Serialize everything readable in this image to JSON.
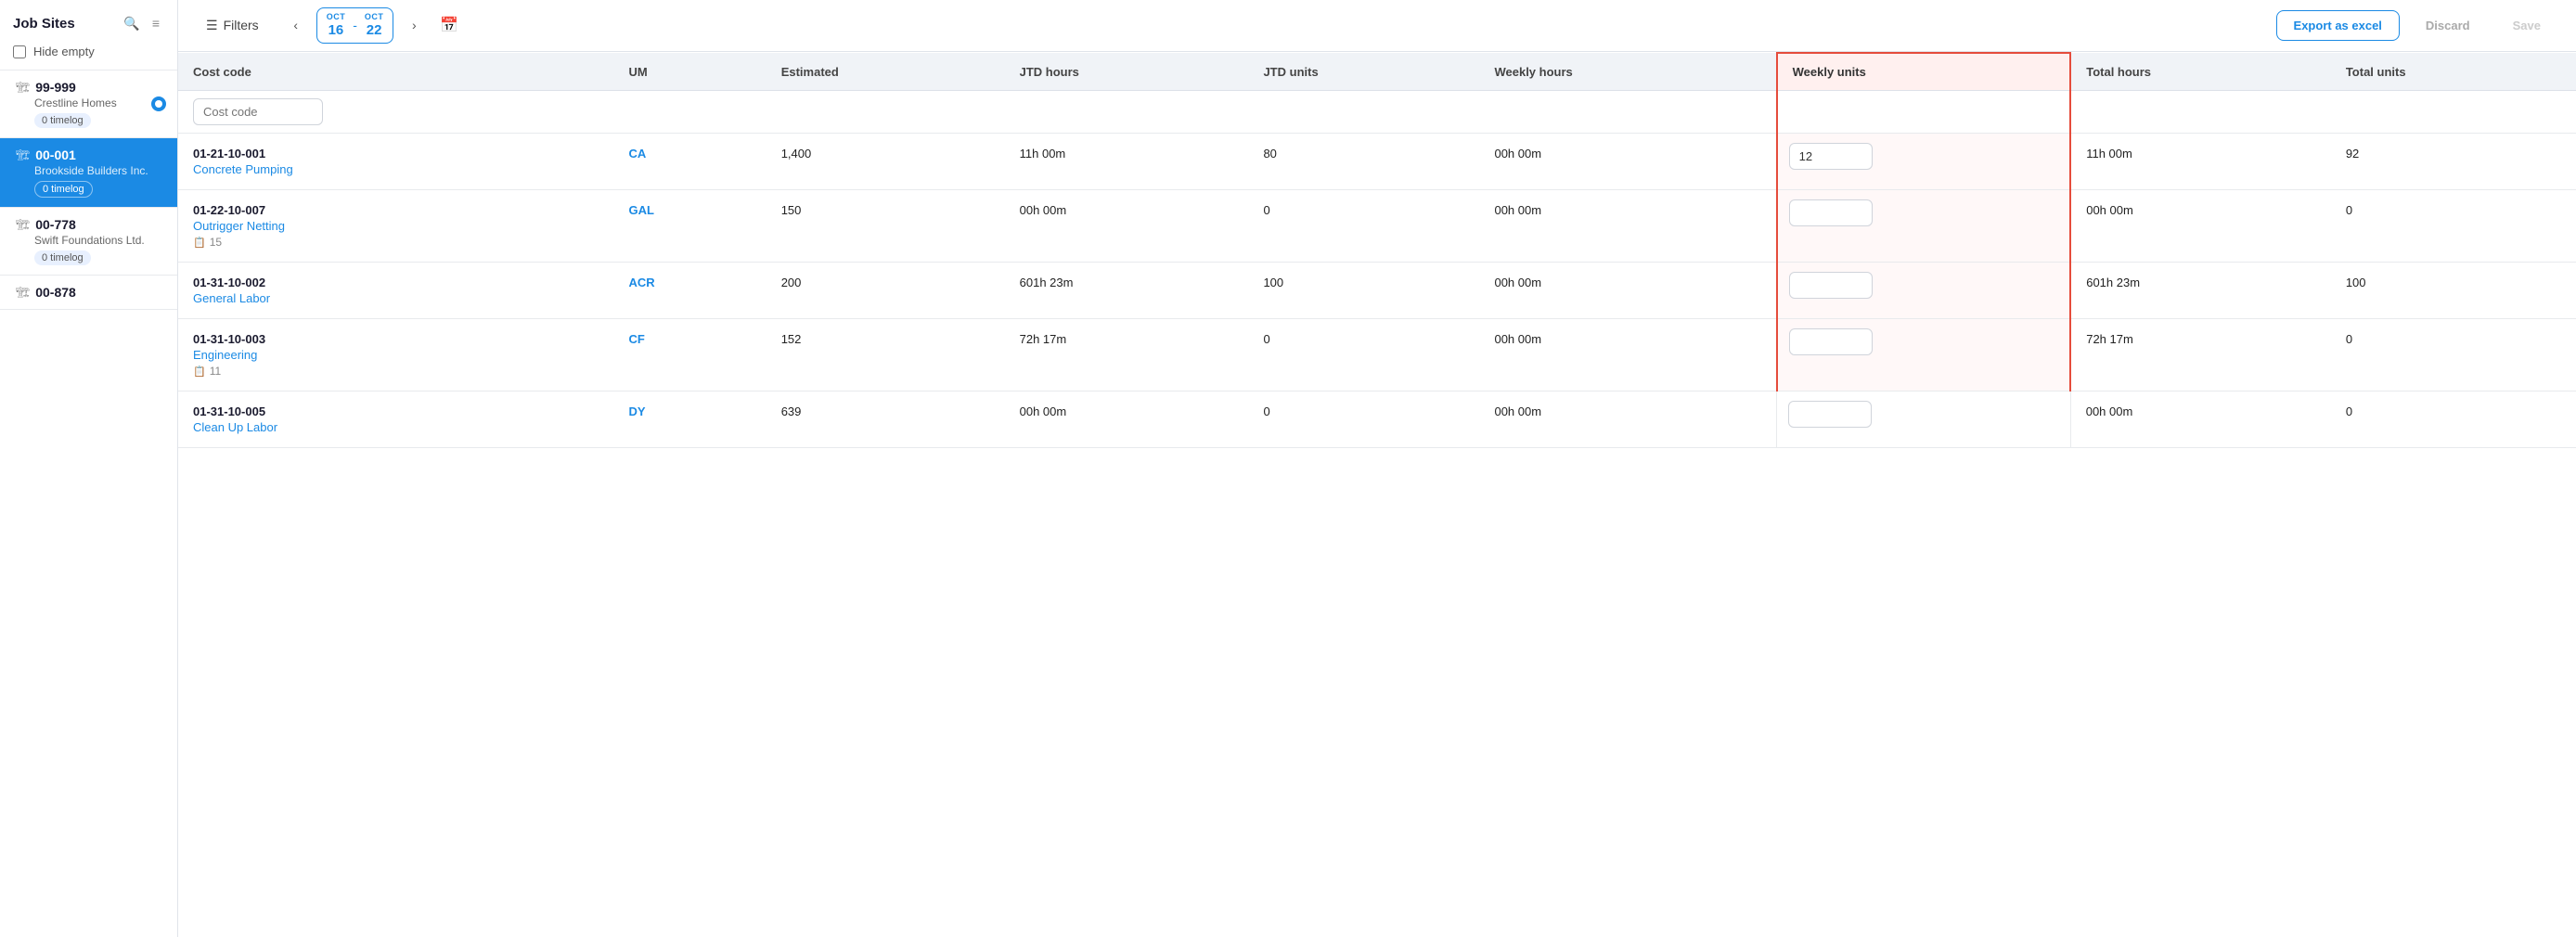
{
  "sidebar": {
    "title": "Job Sites",
    "hide_empty_label": "Hide empty",
    "sites": [
      {
        "id": "99-999",
        "name": "Crestline Homes",
        "timelog": "0 timelog",
        "active": false,
        "notification": false
      },
      {
        "id": "00-001",
        "name": "Brookside Builders Inc.",
        "timelog": "0 timelog",
        "active": true,
        "notification": false
      },
      {
        "id": "00-778",
        "name": "Swift Foundations Ltd.",
        "timelog": "0 timelog",
        "active": false,
        "notification": false
      },
      {
        "id": "00-878",
        "name": "",
        "timelog": "",
        "active": false,
        "notification": false
      }
    ]
  },
  "topbar": {
    "filters_label": "Filters",
    "date_from_month": "OCT",
    "date_from_day": "16",
    "date_to_month": "OCT",
    "date_to_day": "22",
    "export_label": "Export as excel",
    "discard_label": "Discard",
    "save_label": "Save"
  },
  "table": {
    "search_placeholder": "Cost code",
    "headers": [
      "Cost code",
      "UM",
      "Estimated",
      "JTD hours",
      "JTD units",
      "Weekly hours",
      "Weekly units",
      "Total hours",
      "Total units"
    ],
    "rows": [
      {
        "id": "01-21-10-001",
        "name": "Concrete Pumping",
        "sub": null,
        "um": "CA",
        "estimated": "1,400",
        "jtd_hours": "11h 00m",
        "jtd_units": "80",
        "weekly_hours": "00h 00m",
        "weekly_units": "12",
        "total_hours": "11h 00m",
        "total_units": "92",
        "weekly_units_active": true
      },
      {
        "id": "01-22-10-007",
        "name": "Outrigger Netting",
        "sub": "15",
        "um": "GAL",
        "estimated": "150",
        "jtd_hours": "00h 00m",
        "jtd_units": "0",
        "weekly_hours": "00h 00m",
        "weekly_units": "",
        "total_hours": "00h 00m",
        "total_units": "0",
        "weekly_units_active": true
      },
      {
        "id": "01-31-10-002",
        "name": "General Labor",
        "sub": null,
        "um": "ACR",
        "estimated": "200",
        "jtd_hours": "601h 23m",
        "jtd_units": "100",
        "weekly_hours": "00h 00m",
        "weekly_units": "",
        "total_hours": "601h 23m",
        "total_units": "100",
        "weekly_units_active": true
      },
      {
        "id": "01-31-10-003",
        "name": "Engineering",
        "sub": "11",
        "um": "CF",
        "estimated": "152",
        "jtd_hours": "72h 17m",
        "jtd_units": "0",
        "weekly_hours": "00h 00m",
        "weekly_units": "",
        "total_hours": "72h 17m",
        "total_units": "0",
        "weekly_units_active": true
      },
      {
        "id": "01-31-10-005",
        "name": "Clean Up Labor",
        "sub": null,
        "um": "DY",
        "estimated": "639",
        "jtd_hours": "00h 00m",
        "jtd_units": "0",
        "weekly_hours": "00h 00m",
        "weekly_units": "",
        "total_hours": "00h 00m",
        "total_units": "0",
        "weekly_units_active": false
      }
    ]
  }
}
